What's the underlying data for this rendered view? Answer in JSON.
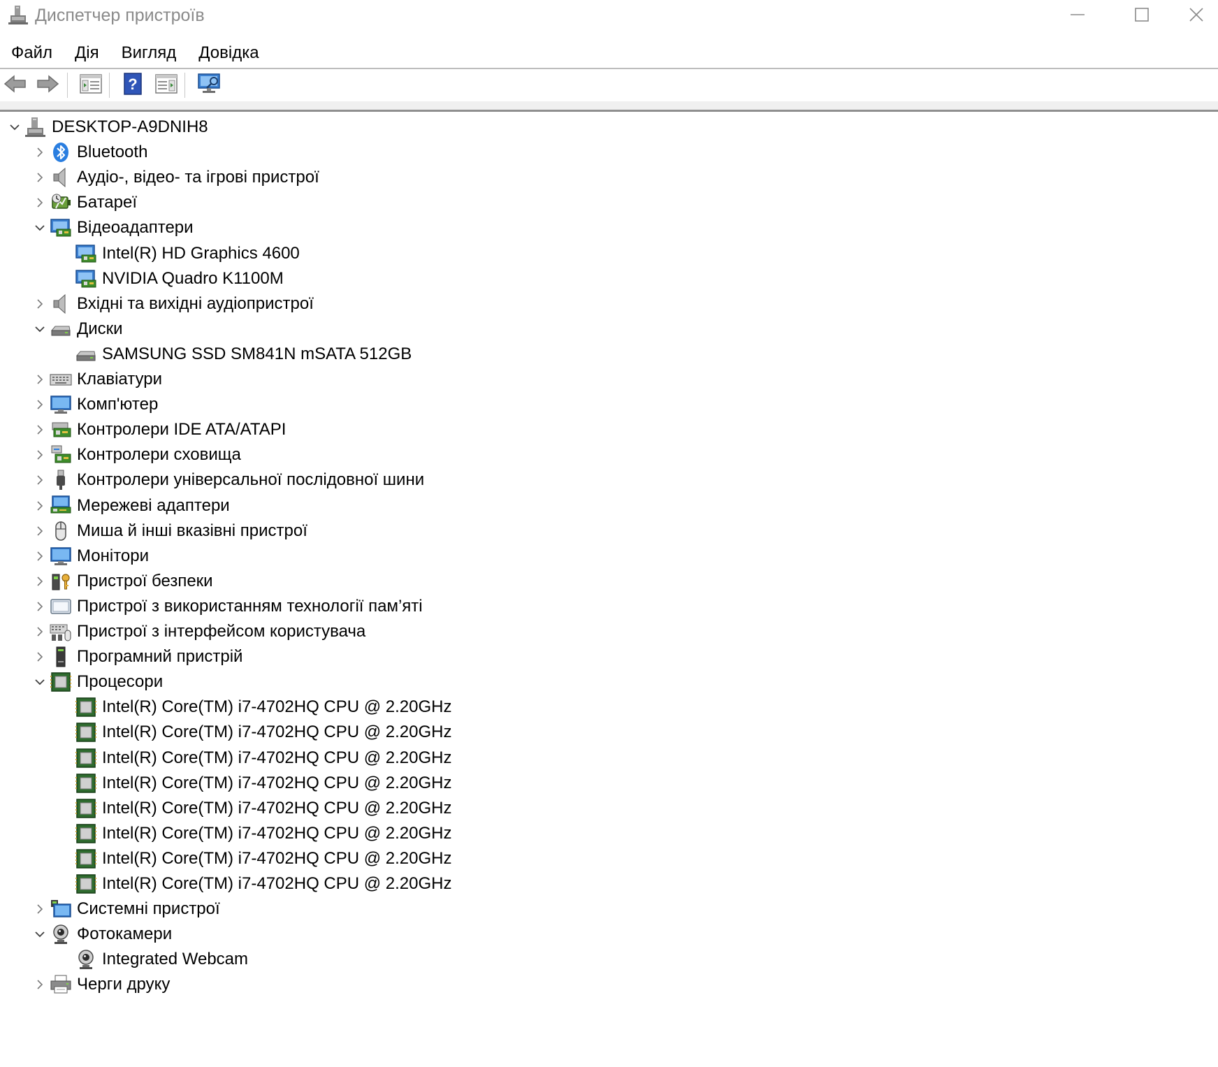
{
  "window": {
    "title": "Диспетчер пристроїв"
  },
  "menu": [
    {
      "label": "Файл"
    },
    {
      "label": "Дія"
    },
    {
      "label": "Вигляд"
    },
    {
      "label": "Довідка"
    }
  ],
  "toolbar": {
    "buttons": [
      "back-icon",
      "forward-icon",
      "properties-icon",
      "help-icon",
      "update-driver-icon",
      "scan-hardware-icon"
    ]
  },
  "tree": {
    "root": "DESKTOP-A9DNIH8",
    "items": [
      {
        "label": "Bluetooth",
        "icon": "bluetooth-icon",
        "expanded": false,
        "children": []
      },
      {
        "label": "Аудіо-, відео- та ігрові пристрої",
        "icon": "speaker-icon",
        "expanded": false,
        "children": []
      },
      {
        "label": "Батареї",
        "icon": "battery-icon",
        "expanded": false,
        "children": []
      },
      {
        "label": "Відеоадаптери",
        "icon": "display-adapter-icon",
        "expanded": true,
        "children": [
          "Intel(R) HD Graphics 4600",
          "NVIDIA Quadro K1100M"
        ]
      },
      {
        "label": "Вхідні та вихідні аудіопристрої",
        "icon": "speaker-icon",
        "expanded": false,
        "children": []
      },
      {
        "label": "Диски",
        "icon": "disk-drive-icon",
        "expanded": true,
        "children": [
          "SAMSUNG SSD SM841N mSATA 512GB"
        ]
      },
      {
        "label": "Клавіатури",
        "icon": "keyboard-icon",
        "expanded": false,
        "children": []
      },
      {
        "label": "Комп'ютер",
        "icon": "computer-icon",
        "expanded": false,
        "children": []
      },
      {
        "label": "Контролери IDE ATA/ATAPI",
        "icon": "ide-controller-icon",
        "expanded": false,
        "children": []
      },
      {
        "label": "Контролери сховища",
        "icon": "storage-controller-icon",
        "expanded": false,
        "children": []
      },
      {
        "label": "Контролери універсальної послідовної шини",
        "icon": "usb-icon",
        "expanded": false,
        "children": []
      },
      {
        "label": "Мережеві адаптери",
        "icon": "network-adapter-icon",
        "expanded": false,
        "children": []
      },
      {
        "label": "Миша й інші вказівні пристрої",
        "icon": "mouse-icon",
        "expanded": false,
        "children": []
      },
      {
        "label": "Монітори",
        "icon": "monitor-icon",
        "expanded": false,
        "children": []
      },
      {
        "label": "Пристрої безпеки",
        "icon": "security-device-icon",
        "expanded": false,
        "children": []
      },
      {
        "label": "Пристрої з використанням технології пам’яті",
        "icon": "memory-device-icon",
        "expanded": false,
        "children": []
      },
      {
        "label": "Пристрої з інтерфейсом користувача",
        "icon": "hid-icon",
        "expanded": false,
        "children": []
      },
      {
        "label": "Програмний пристрій",
        "icon": "software-device-icon",
        "expanded": false,
        "children": []
      },
      {
        "label": "Процесори",
        "icon": "processor-icon",
        "expanded": true,
        "children": [
          "Intel(R) Core(TM) i7-4702HQ CPU @ 2.20GHz",
          "Intel(R) Core(TM) i7-4702HQ CPU @ 2.20GHz",
          "Intel(R) Core(TM) i7-4702HQ CPU @ 2.20GHz",
          "Intel(R) Core(TM) i7-4702HQ CPU @ 2.20GHz",
          "Intel(R) Core(TM) i7-4702HQ CPU @ 2.20GHz",
          "Intel(R) Core(TM) i7-4702HQ CPU @ 2.20GHz",
          "Intel(R) Core(TM) i7-4702HQ CPU @ 2.20GHz",
          "Intel(R) Core(TM) i7-4702HQ CPU @ 2.20GHz"
        ]
      },
      {
        "label": "Системні пристрої",
        "icon": "system-device-icon",
        "expanded": false,
        "children": []
      },
      {
        "label": "Фотокамери",
        "icon": "camera-icon",
        "expanded": true,
        "children": [
          "Integrated Webcam"
        ]
      },
      {
        "label": "Черги друку",
        "icon": "printer-icon",
        "expanded": false,
        "children": []
      }
    ]
  }
}
